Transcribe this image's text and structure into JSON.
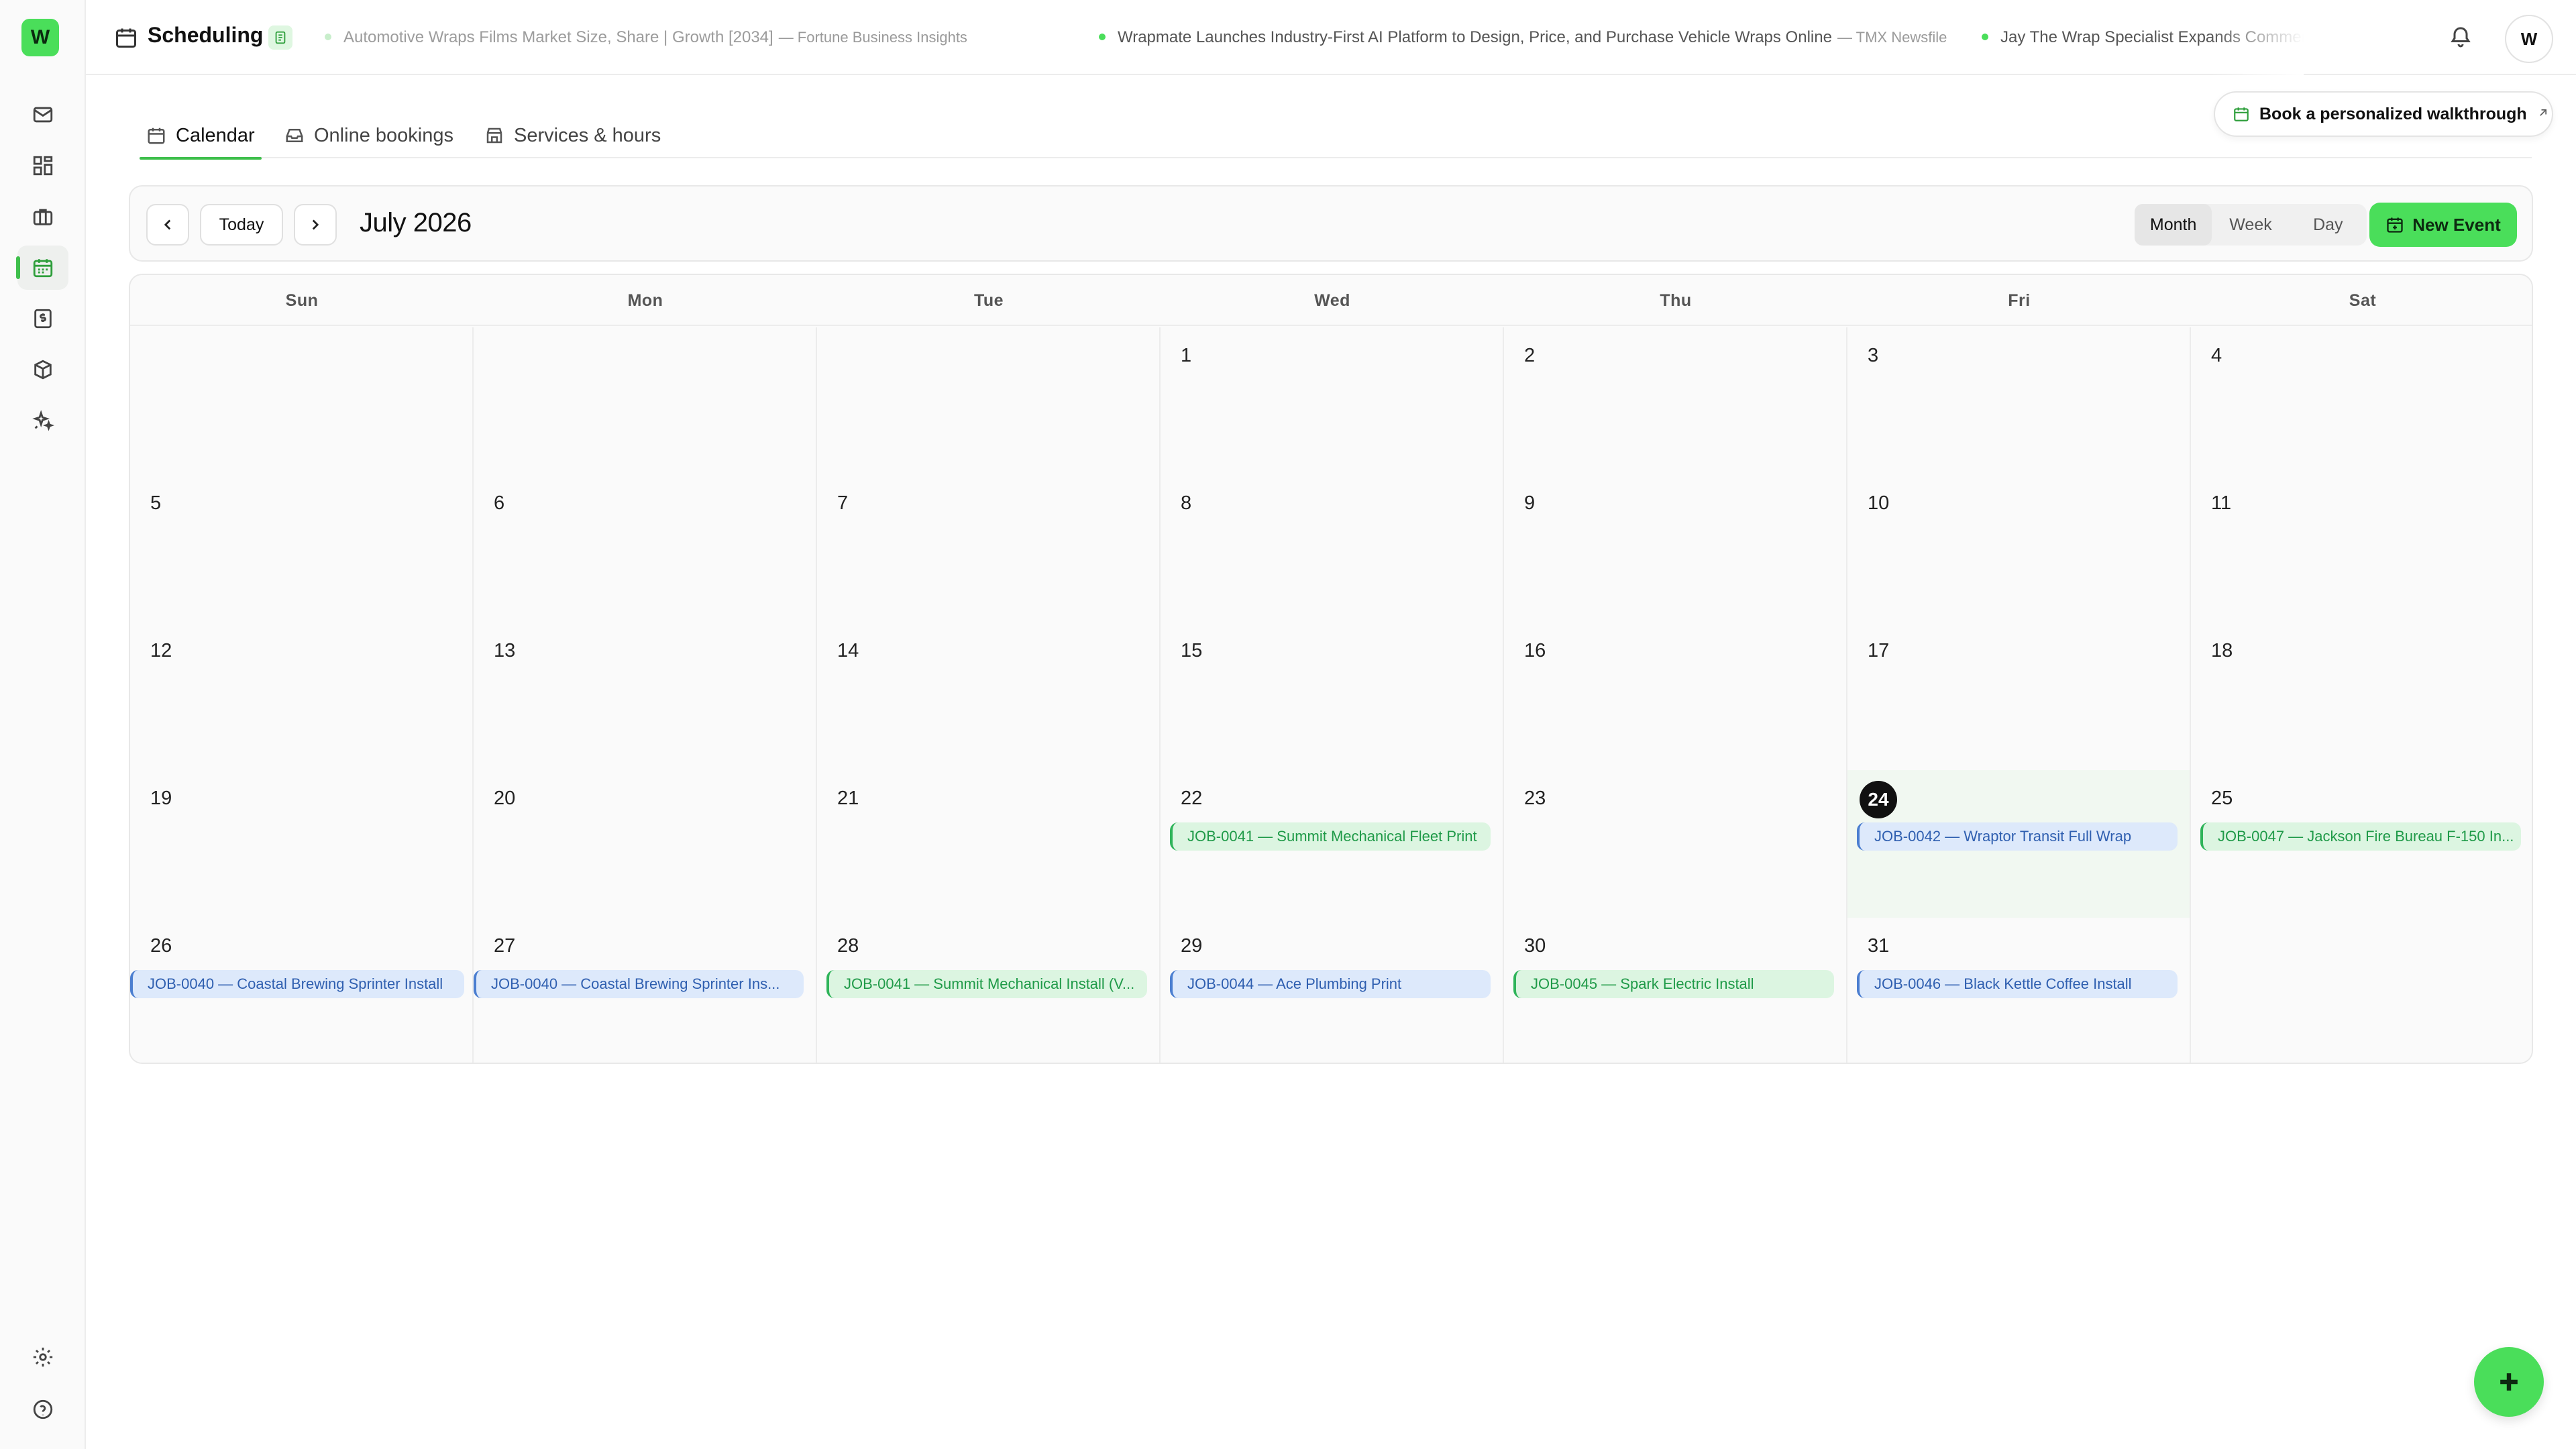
{
  "app": {
    "logo_letter": "W",
    "user_initial": "W"
  },
  "header": {
    "title": "Scheduling",
    "ticker": [
      {
        "headline": "Automotive Wraps Films Market Size, Share | Growth [2034]",
        "source": "— Fortune Business Insights"
      },
      {
        "headline": "Wrapmate Launches Industry-First AI Platform to Design, Price, and Purchase Vehicle Wraps Online",
        "source": "— TMX Newsfile"
      },
      {
        "headline": "Jay The Wrap Specialist Expands Commercial Vehicle Wrap Services fo",
        "source": ""
      }
    ]
  },
  "tabs": [
    {
      "label": "Calendar"
    },
    {
      "label": "Online bookings"
    },
    {
      "label": "Services & hours"
    }
  ],
  "walkthrough": {
    "label": "Book a personalized walkthrough"
  },
  "toolbar": {
    "today_label": "Today",
    "month_label": "July 2026",
    "views": [
      "Month",
      "Week",
      "Day"
    ],
    "active_view": "Month",
    "new_event_label": "New Event"
  },
  "calendar": {
    "weekdays": [
      "Sun",
      "Mon",
      "Tue",
      "Wed",
      "Thu",
      "Fri",
      "Sat"
    ],
    "weeks": [
      [
        "",
        "",
        "",
        "1",
        "2",
        "3",
        "4"
      ],
      [
        "5",
        "6",
        "7",
        "8",
        "9",
        "10",
        "11"
      ],
      [
        "12",
        "13",
        "14",
        "15",
        "16",
        "17",
        "18"
      ],
      [
        "19",
        "20",
        "21",
        "22",
        "23",
        "24",
        "25"
      ],
      [
        "26",
        "27",
        "28",
        "29",
        "30",
        "31",
        ""
      ]
    ],
    "today": "24",
    "events": [
      {
        "week": 3,
        "day": 3,
        "label": "JOB-0041 — Summit Mechanical Fleet Print",
        "color": "green"
      },
      {
        "week": 3,
        "day": 5,
        "label": "JOB-0042 — Wraptor Transit Full Wrap",
        "color": "blue"
      },
      {
        "week": 3,
        "day": 6,
        "label": "JOB-0047 — Jackson Fire Bureau F-150 In...",
        "color": "green"
      },
      {
        "week": 4,
        "day": 0,
        "label": "JOB-0040 — Coastal Brewing Sprinter Install",
        "color": "blue"
      },
      {
        "week": 4,
        "day": 1,
        "label": "JOB-0040 — Coastal Brewing Sprinter Ins...",
        "color": "blue"
      },
      {
        "week": 4,
        "day": 2,
        "label": "JOB-0041 — Summit Mechanical Install (V...",
        "color": "green"
      },
      {
        "week": 4,
        "day": 3,
        "label": "JOB-0044 — Ace Plumbing Print",
        "color": "blue"
      },
      {
        "week": 4,
        "day": 4,
        "label": "JOB-0045 — Spark Electric Install",
        "color": "green"
      },
      {
        "week": 4,
        "day": 5,
        "label": "JOB-0046 — Black Kettle Coffee Install",
        "color": "blue"
      }
    ]
  }
}
